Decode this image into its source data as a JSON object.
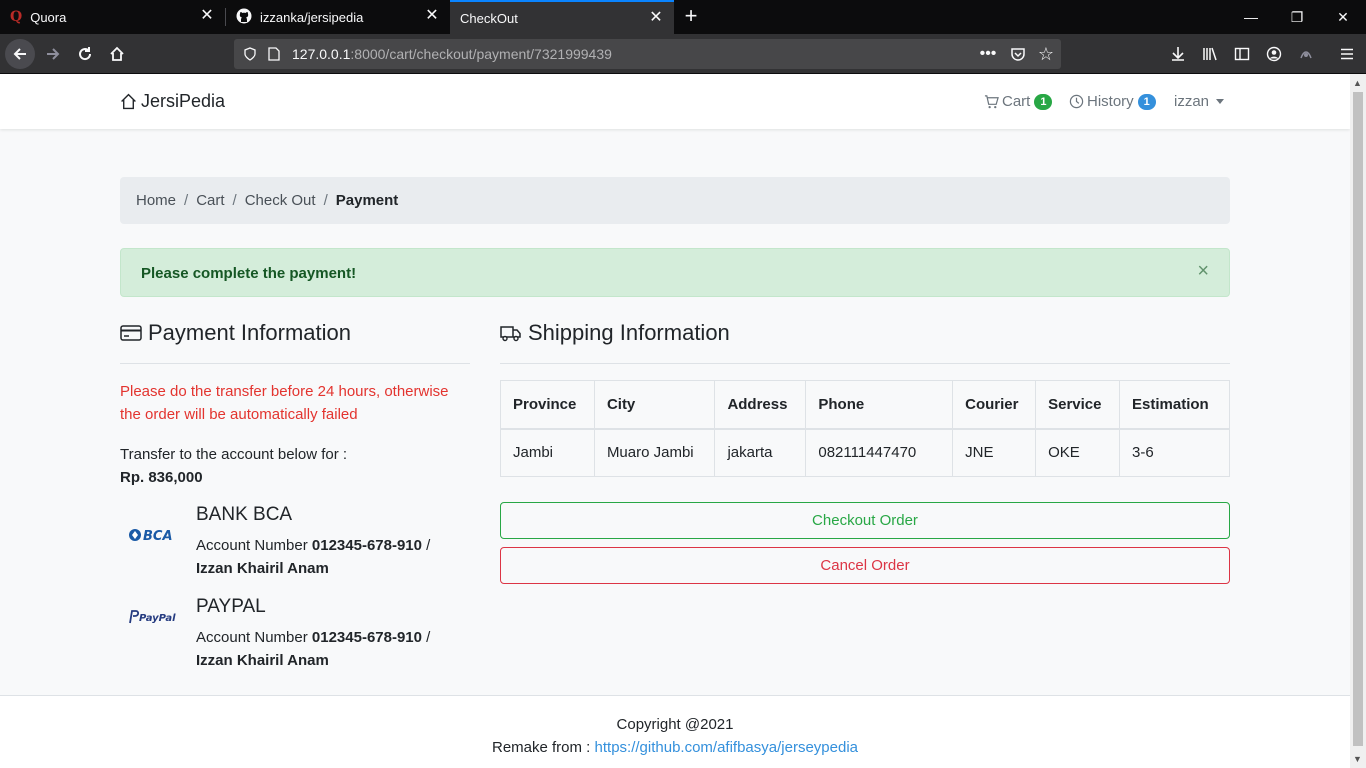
{
  "browser": {
    "tabs": [
      {
        "title": "Quora",
        "icon": "quora-icon"
      },
      {
        "title": "izzanka/jersipedia",
        "icon": "github-icon"
      },
      {
        "title": "CheckOut",
        "icon": ""
      }
    ],
    "url_host": "127.0.0.1",
    "url_path": ":8000/cart/checkout/payment/7321999439"
  },
  "site_nav": {
    "brand": "JersiPedia",
    "cart_label": "Cart",
    "cart_count": "1",
    "history_label": "History",
    "history_count": "1",
    "user": "izzan"
  },
  "breadcrumb": {
    "items": [
      "Home",
      "Cart",
      "Check Out"
    ],
    "active": "Payment"
  },
  "alert": {
    "message": "Please complete the payment!",
    "close": "×"
  },
  "payment": {
    "title": "Payment Information",
    "warning": "Please do the transfer before 24 hours, otherwise the order will be automatically failed",
    "transfer_label": "Transfer to the account below for :",
    "amount": "Rp. 836,000",
    "banks": [
      {
        "name": "BANK BCA",
        "logo_text": "BCA",
        "acc_label": "Account Number",
        "acc_number": "012345-678-910",
        "sep": "/",
        "holder": "Izzan Khairil Anam"
      },
      {
        "name": "PAYPAL",
        "logo_text": "PayPal",
        "acc_label": "Account Number",
        "acc_number": "012345-678-910",
        "sep": "/",
        "holder": "Izzan Khairil Anam"
      }
    ]
  },
  "shipping": {
    "title": "Shipping Information",
    "headers": [
      "Province",
      "City",
      "Address",
      "Phone",
      "Courier",
      "Service",
      "Estimation"
    ],
    "row": [
      "Jambi",
      "Muaro Jambi",
      "jakarta",
      "082111447470",
      "JNE",
      "OKE",
      "3-6"
    ]
  },
  "buttons": {
    "checkout": "Checkout Order",
    "cancel": "Cancel Order"
  },
  "footer": {
    "copyright": "Copyright @2021",
    "remake_label": "Remake from :",
    "remake_link": "https://github.com/afifbasya/jerseypedia"
  },
  "colors": {
    "success": "#28a745",
    "danger": "#dc3545",
    "link": "#3490dc",
    "alert_bg": "#d4edda"
  }
}
